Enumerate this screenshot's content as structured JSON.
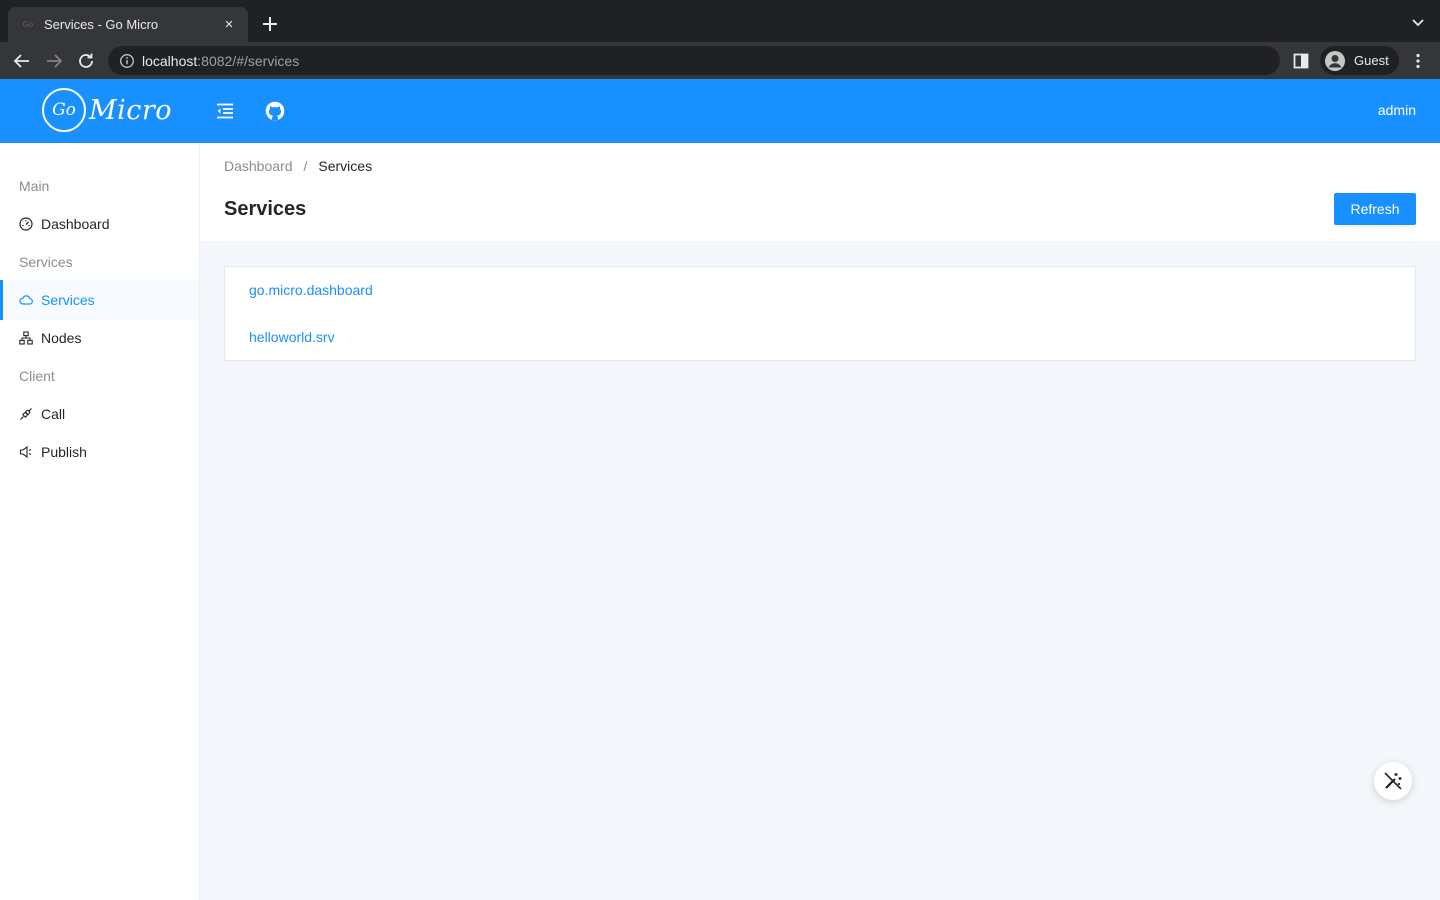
{
  "browser": {
    "tab_title": "Services - Go Micro",
    "tab_favicon": "Go",
    "tab_close": "×",
    "url_host": "localhost",
    "url_rest": ":8082/#/services",
    "profile_label": "Guest"
  },
  "header": {
    "logo_mark": "Go",
    "logo_word": "Micro",
    "user": "admin"
  },
  "sidebar": {
    "groups": [
      {
        "label": "Main"
      },
      {
        "label": "Services"
      },
      {
        "label": "Client"
      }
    ],
    "items": [
      {
        "label": "Dashboard",
        "icon": "dashboard-icon",
        "active": false
      },
      {
        "label": "Services",
        "icon": "cloud-icon",
        "active": true
      },
      {
        "label": "Nodes",
        "icon": "cluster-icon",
        "active": false
      },
      {
        "label": "Call",
        "icon": "api-icon",
        "active": false
      },
      {
        "label": "Publish",
        "icon": "sound-icon",
        "active": false
      }
    ]
  },
  "page": {
    "breadcrumb": [
      {
        "label": "Dashboard"
      },
      {
        "label": "Services"
      }
    ],
    "breadcrumb_separator": "/",
    "title": "Services",
    "refresh_label": "Refresh"
  },
  "services": [
    {
      "name": "go.micro.dashboard"
    },
    {
      "name": "helloworld.srv"
    }
  ],
  "colors": {
    "primary": "#1890ff",
    "chrome_dark": "#202124",
    "chrome_toolbar": "#35363a",
    "content_bg": "#f3f6fa"
  }
}
